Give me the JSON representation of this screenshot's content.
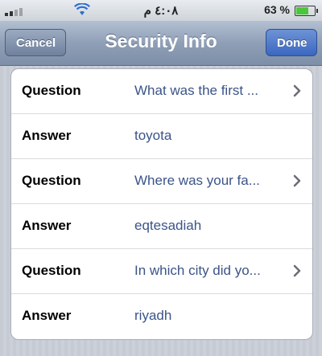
{
  "status_bar": {
    "time": "٤:٠٨ م",
    "battery_percent": "63 %",
    "battery_level": 0.63,
    "icons": [
      "signal-icon",
      "wifi-icon",
      "battery-icon"
    ]
  },
  "nav": {
    "title": "Security Info",
    "cancel_label": "Cancel",
    "done_label": "Done"
  },
  "rows": [
    {
      "label": "Question",
      "value": "What was the first ...",
      "chevron": true
    },
    {
      "label": "Answer",
      "value": "toyota",
      "chevron": false
    },
    {
      "label": "Question",
      "value": "Where was your fa...",
      "chevron": true
    },
    {
      "label": "Answer",
      "value": "eqtesadiah",
      "chevron": false
    },
    {
      "label": "Question",
      "value": "In which city did yo...",
      "chevron": true
    },
    {
      "label": "Answer",
      "value": "riyadh",
      "chevron": false
    }
  ],
  "colors": {
    "value_text": "#3b5488",
    "nav_gradient": "#8f9fb6",
    "done_button": "#3b67c0"
  }
}
